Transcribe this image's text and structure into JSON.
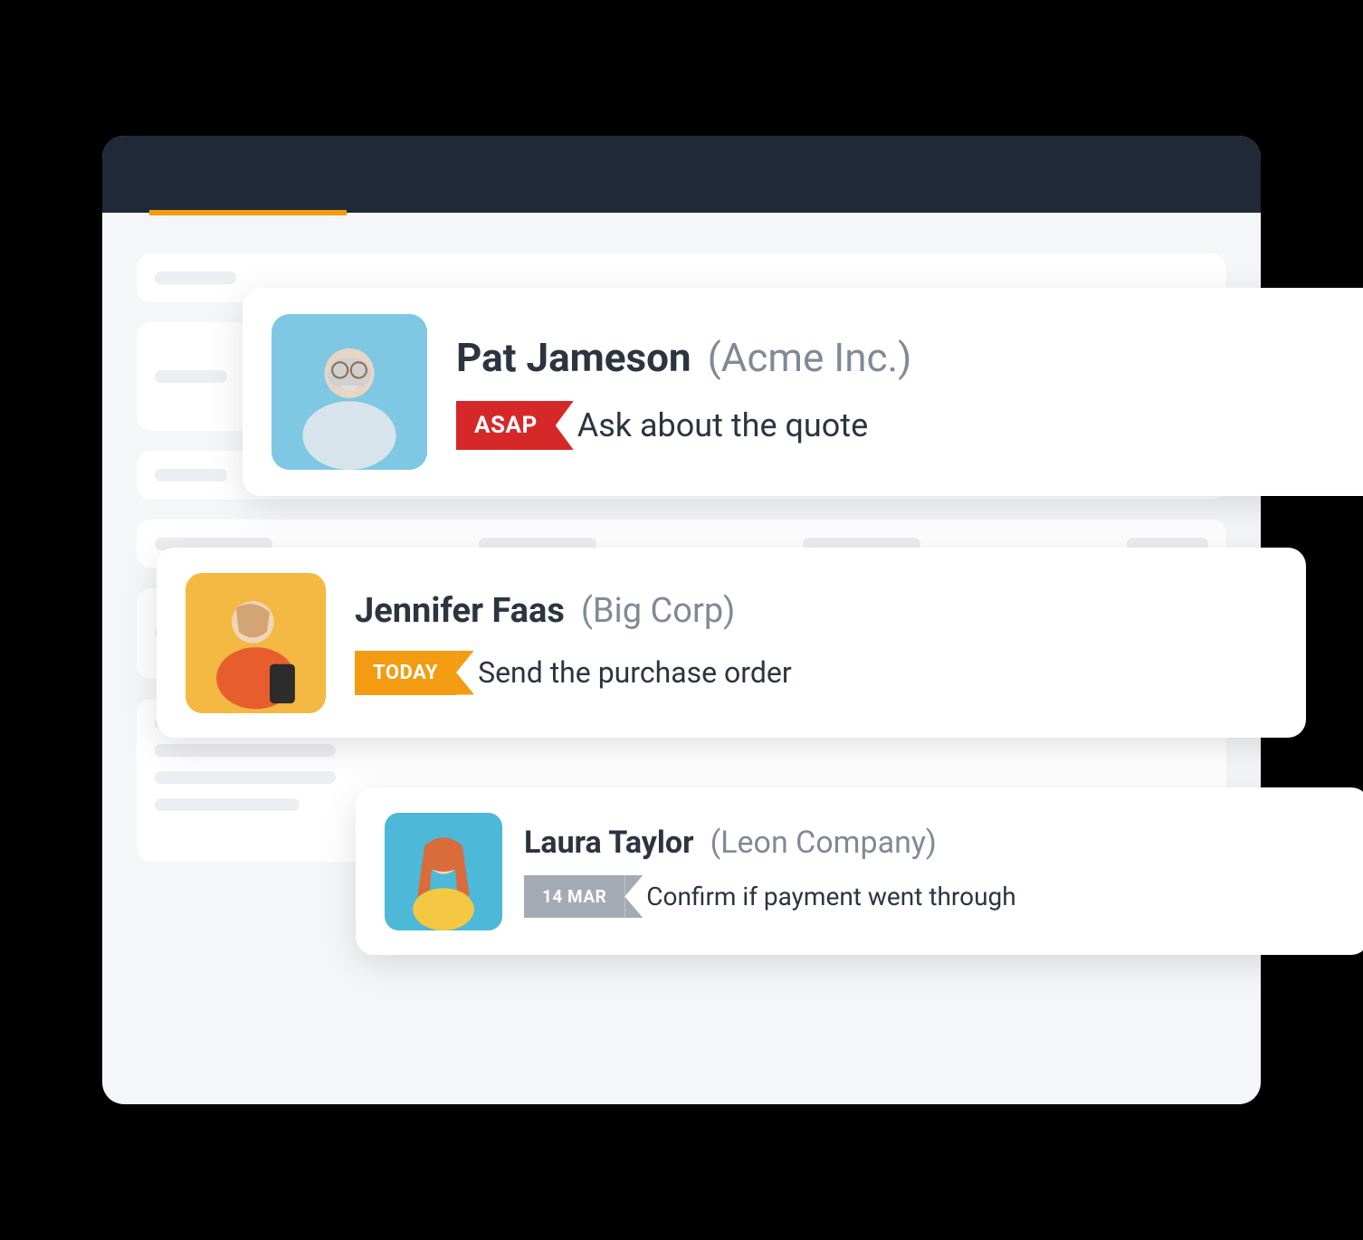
{
  "cards": [
    {
      "name": "Pat Jameson",
      "company": "(Acme Inc.)",
      "priority_label": "ASAP",
      "priority_type": "asap",
      "action": "Ask about the quote"
    },
    {
      "name": "Jennifer Faas",
      "company": "(Big Corp)",
      "priority_label": "TODAY",
      "priority_type": "today",
      "action": "Send the purchase order"
    },
    {
      "name": "Laura Taylor",
      "company": "(Leon Company)",
      "priority_label": "14 MAR",
      "priority_type": "date",
      "action": "Confirm if payment went through"
    }
  ]
}
